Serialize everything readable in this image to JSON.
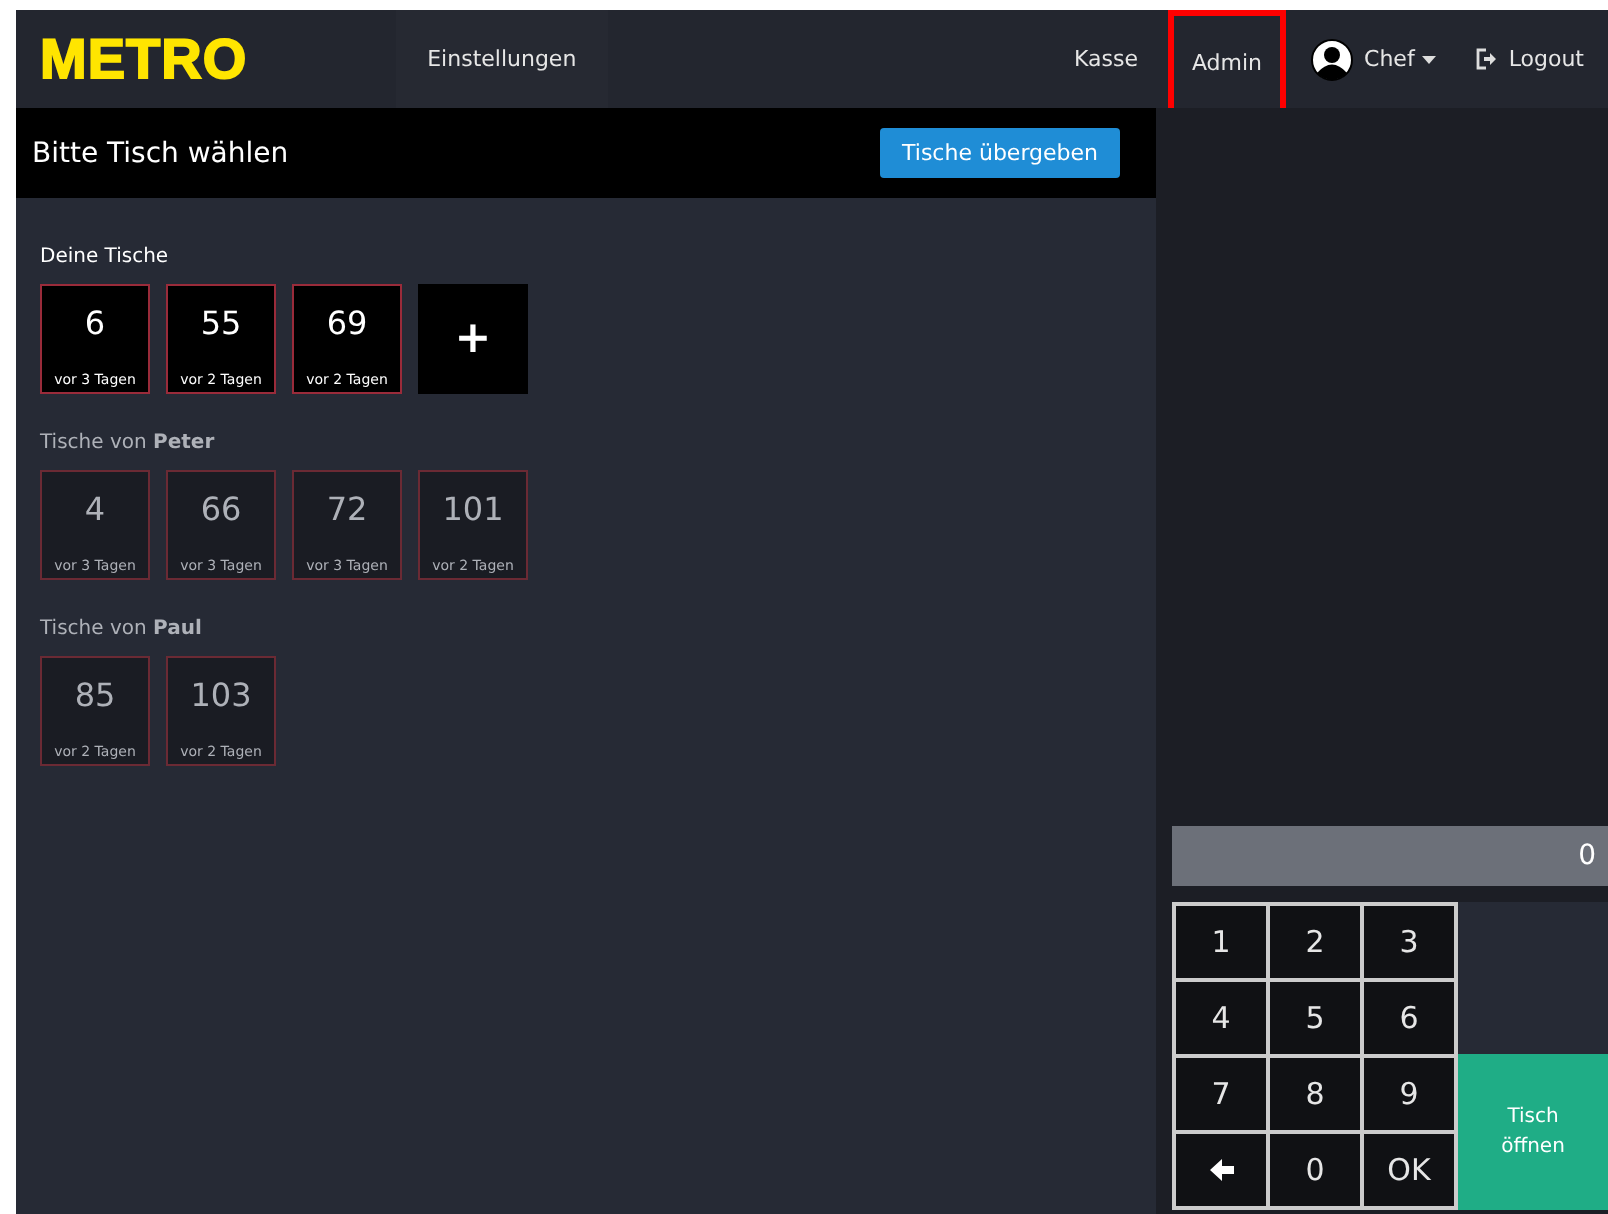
{
  "navbar": {
    "logo": "METRO",
    "left_items": [
      {
        "label": "Einstellungen",
        "selected": true
      }
    ],
    "right_items": [
      {
        "label": "Kasse",
        "highlighted": false
      },
      {
        "label": "Admin",
        "highlighted": true
      }
    ],
    "user": {
      "label": "Chef"
    },
    "logout": {
      "label": "Logout"
    }
  },
  "header": {
    "title": "Bitte Tisch wählen",
    "button": "Tische übergeben"
  },
  "sections": [
    {
      "heading": "Deine Tische",
      "tables": [
        {
          "number": "6",
          "age": "vor 3 Tagen",
          "own": true
        },
        {
          "number": "55",
          "age": "vor 2 Tagen",
          "own": true
        },
        {
          "number": "69",
          "age": "vor 2 Tagen",
          "own": true
        }
      ],
      "add_button": "+"
    },
    {
      "heading": "Tische von **Peter**",
      "tables": [
        {
          "number": "4",
          "age": "vor 3 Tagen",
          "own": false
        },
        {
          "number": "66",
          "age": "vor 3 Tagen",
          "own": false
        },
        {
          "number": "72",
          "age": "vor 3 Tagen",
          "own": false
        },
        {
          "number": "101",
          "age": "vor 2 Tagen",
          "own": false
        }
      ]
    },
    {
      "heading": "Tische von **Paul**",
      "tables": [
        {
          "number": "85",
          "age": "vor 2 Tagen",
          "own": false
        },
        {
          "number": "103",
          "age": "vor 2 Tagen",
          "own": false
        }
      ]
    }
  ],
  "keypad": {
    "display": "0",
    "keys": [
      {
        "kind": "digit",
        "label": "1"
      },
      {
        "kind": "digit",
        "label": "2"
      },
      {
        "kind": "digit",
        "label": "3"
      },
      {
        "kind": "digit",
        "label": "4"
      },
      {
        "kind": "digit",
        "label": "5"
      },
      {
        "kind": "digit",
        "label": "6"
      },
      {
        "kind": "digit",
        "label": "7"
      },
      {
        "kind": "digit",
        "label": "8"
      },
      {
        "kind": "digit",
        "label": "9"
      },
      {
        "kind": "back"
      },
      {
        "kind": "digit",
        "label": "0"
      },
      {
        "kind": "digit",
        "label": "OK"
      }
    ],
    "open_button": "Tisch öffnen"
  }
}
